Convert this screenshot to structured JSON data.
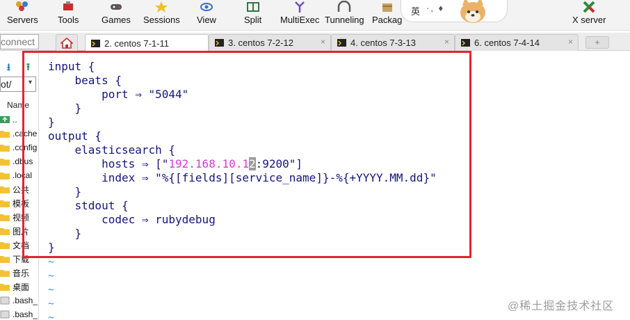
{
  "toolbar": {
    "items": [
      {
        "label": "Servers",
        "icon": "servers-icon"
      },
      {
        "label": "Tools",
        "icon": "tools-icon"
      },
      {
        "label": "Games",
        "icon": "games-icon"
      },
      {
        "label": "Sessions",
        "icon": "sessions-icon"
      },
      {
        "label": "View",
        "icon": "view-icon"
      },
      {
        "label": "Split",
        "icon": "split-icon"
      },
      {
        "label": "MultiExec",
        "icon": "multiexec-icon"
      },
      {
        "label": "Tunneling",
        "icon": "tunneling-icon"
      },
      {
        "label": "Packag",
        "icon": "packages-icon"
      },
      {
        "label": "X server",
        "icon": "xserver-icon"
      }
    ],
    "ime_label": "英",
    "ime_dots": "·, ♦"
  },
  "tabbar": {
    "quick_connect": "connect",
    "tabs": [
      {
        "label": "2. centos 7-1-11",
        "active": true
      },
      {
        "label": "3. centos 7-2-12",
        "active": false
      },
      {
        "label": "4. centos 7-3-13",
        "active": false
      },
      {
        "label": "6. centos 7-4-14",
        "active": false
      }
    ],
    "close_glyph": "×",
    "new_tab_glyph": "+"
  },
  "sidebar": {
    "download_glyph": "⭳",
    "upload_glyph": "⭱",
    "path": "ot/",
    "path_arrow": "▾",
    "column_name": "Name",
    "files": [
      {
        "name": "..",
        "type": "up"
      },
      {
        "name": ".cache",
        "type": "folder"
      },
      {
        "name": ".config",
        "type": "folder"
      },
      {
        "name": ".dbus",
        "type": "folder"
      },
      {
        "name": ".local",
        "type": "folder"
      },
      {
        "name": "公共",
        "type": "folder"
      },
      {
        "name": "模板",
        "type": "folder"
      },
      {
        "name": "视频",
        "type": "folder"
      },
      {
        "name": "图片",
        "type": "folder"
      },
      {
        "name": "文档",
        "type": "folder"
      },
      {
        "name": "下载",
        "type": "folder"
      },
      {
        "name": "音乐",
        "type": "folder"
      },
      {
        "name": "桌面",
        "type": "folder"
      },
      {
        "name": ".bash_",
        "type": "file"
      },
      {
        "name": ".bash_",
        "type": "file"
      }
    ]
  },
  "terminal": {
    "lines": {
      "l1": "input {",
      "l2": "    beats {",
      "l3": "        port ⇒ \"5044\"",
      "l4": "    }",
      "l5": "}",
      "l6": "output {",
      "l7": "    elasticsearch {",
      "l8_pre": "        hosts ⇒ [\"",
      "l8_ip": "192.168.10.1",
      "l8_cursor": "2",
      "l8_post": ":9200\"]",
      "l9": "        index ⇒ \"%{[fields][service_name]}-%{+YYYY.MM.dd}\"",
      "l10": "    }",
      "l11": "    stdout {",
      "l12": "        codec ⇒ rubydebug",
      "l13": "    }",
      "l14": "}"
    },
    "tilde": "~"
  },
  "watermark": "@稀土掘金技术社区",
  "colors": {
    "highlight": "#e0262f",
    "code_text": "#15157a",
    "ip_text": "#d63ad6",
    "tilde": "#3aa0c8"
  }
}
